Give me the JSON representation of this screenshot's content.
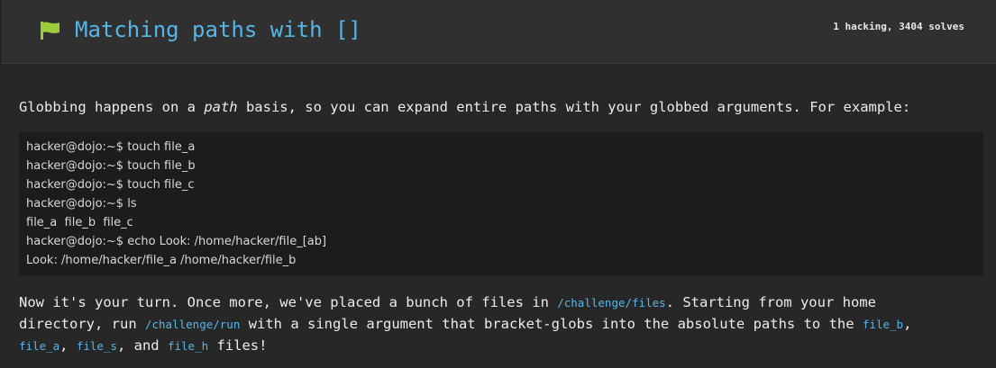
{
  "header": {
    "flag_icon": "flag-icon",
    "flag_color": "#9ccc3c",
    "title": "Matching paths with []",
    "stats": "1 hacking, 3404 solves"
  },
  "intro": {
    "before_em": "Globbing happens on a ",
    "em": "path",
    "after_em": " basis, so you can expand entire paths with your globbed arguments. For example:"
  },
  "code_lines": [
    "hacker@dojo:~$ touch file_a",
    "hacker@dojo:~$ touch file_b",
    "hacker@dojo:~$ touch file_c",
    "hacker@dojo:~$ ls",
    "file_a  file_b  file_c",
    "hacker@dojo:~$ echo Look: /home/hacker/file_[ab]",
    "Look: /home/hacker/file_a /home/hacker/file_b"
  ],
  "paragraph": {
    "t1": "Now it's your turn. Once more, we've placed a bunch of files in ",
    "c1": "/challenge/files",
    "t2": ". Starting from your home",
    "t3": "directory, run ",
    "c2": "/challenge/run",
    "t4": " with a single argument that bracket-globs into the absolute paths to the ",
    "c3": "file_b",
    "t5": ",",
    "c4": "file_a",
    "t6": ", ",
    "c5": "file_s",
    "t7": ", and ",
    "c6": "file_h",
    "t8": " files!"
  },
  "colors": {
    "accent": "#56b6e8",
    "background": "#272727",
    "header": "#303030",
    "code_bg": "#1c1c1c"
  }
}
